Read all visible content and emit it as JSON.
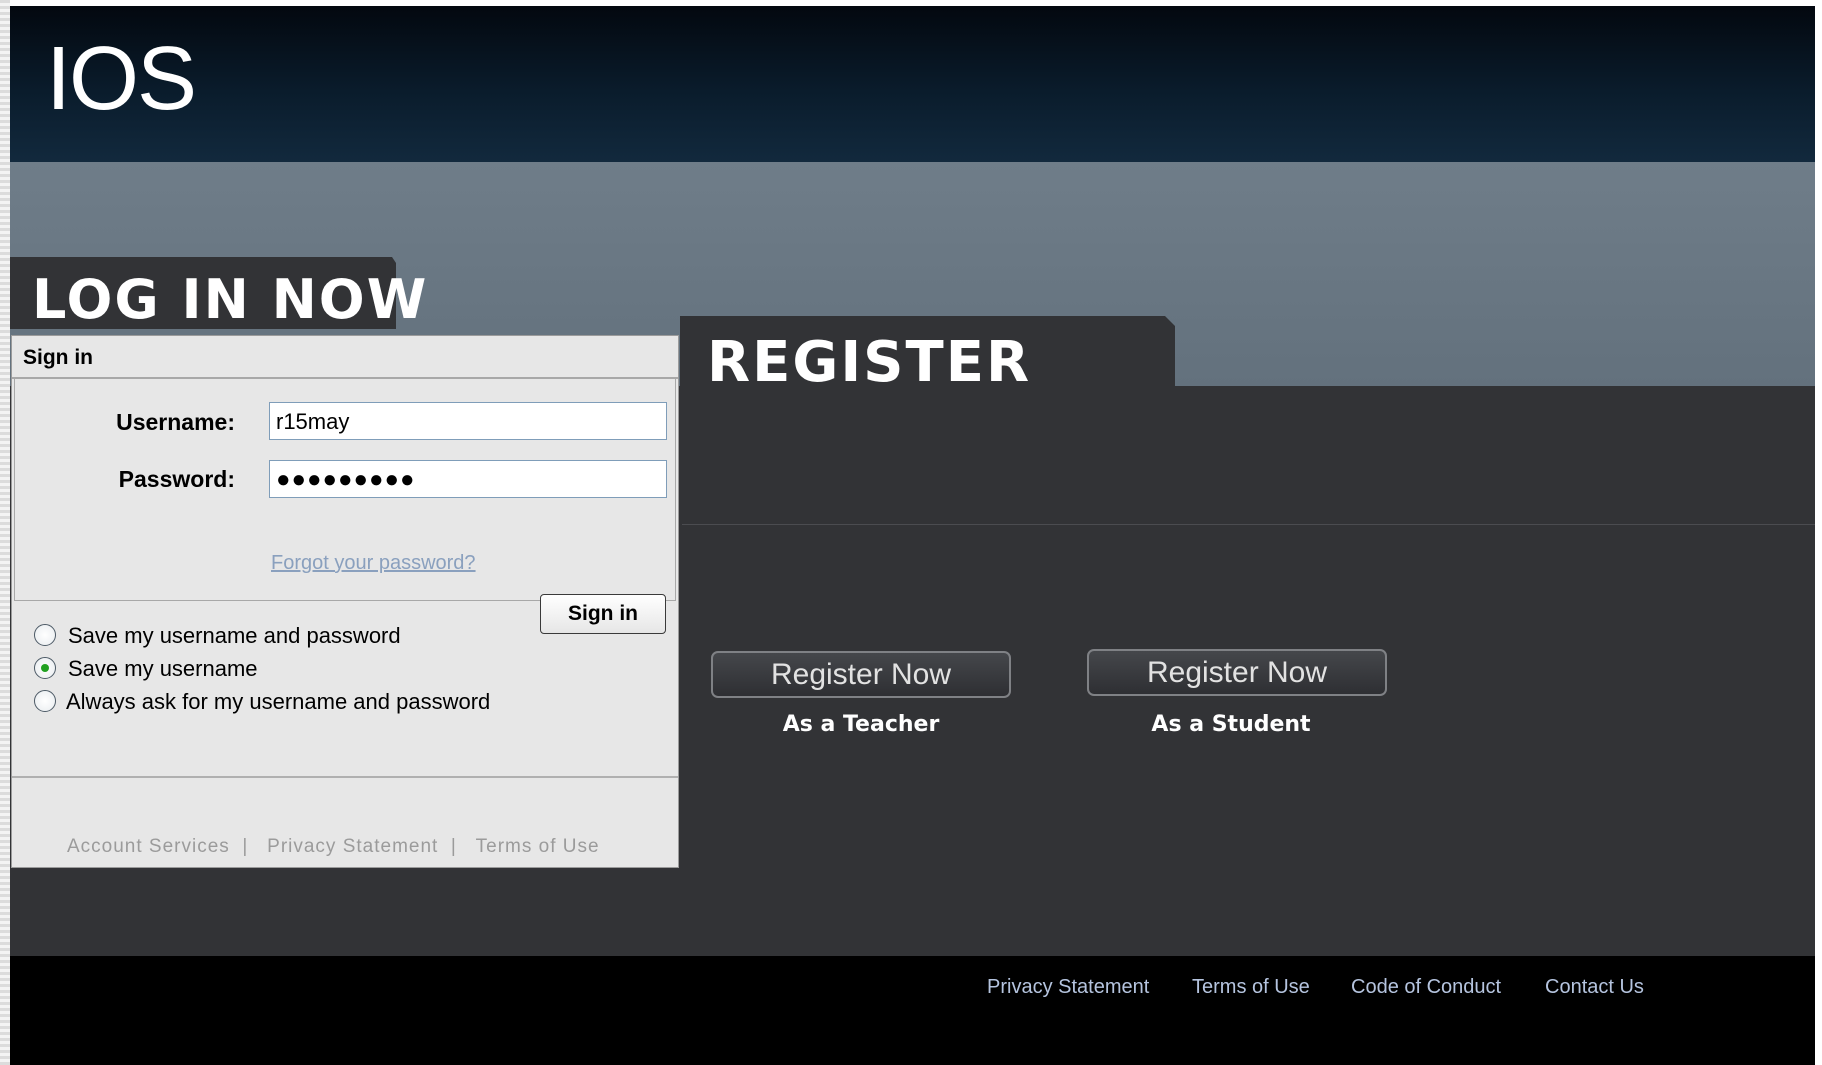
{
  "logo": "IOS",
  "login": {
    "title": "LOG IN NOW",
    "panel_heading": "Sign in",
    "username_label": "Username:",
    "username_value": "r15may",
    "password_label": "Password:",
    "password_masked": "●●●●●●●●●",
    "forgot_link": "Forgot your password?",
    "signin_button": "Sign in",
    "options": [
      {
        "label": "Save my username and password",
        "selected": false
      },
      {
        "label": "Save my username",
        "selected": true
      },
      {
        "label": "Always ask for my  username and password",
        "selected": false
      }
    ],
    "links": [
      "Account Services",
      "Privacy Statement",
      "Terms of Use"
    ]
  },
  "register": {
    "title": "REGISTER",
    "buttons": [
      {
        "label": "Register Now",
        "caption": "As a Teacher"
      },
      {
        "label": "Register Now",
        "caption": "As a Student"
      }
    ]
  },
  "footer": {
    "links": [
      "Privacy Statement",
      "Terms of Use",
      "Code of Conduct",
      "Contact Us"
    ]
  },
  "colors": {
    "header_dark": "#0a1c2c",
    "band": "#6b7985",
    "content_bg": "#323336",
    "panel_bg": "#e7e7e7",
    "footer_bg": "#000000",
    "footer_link": "#b5c4df",
    "radio_selected": "#21a121"
  }
}
